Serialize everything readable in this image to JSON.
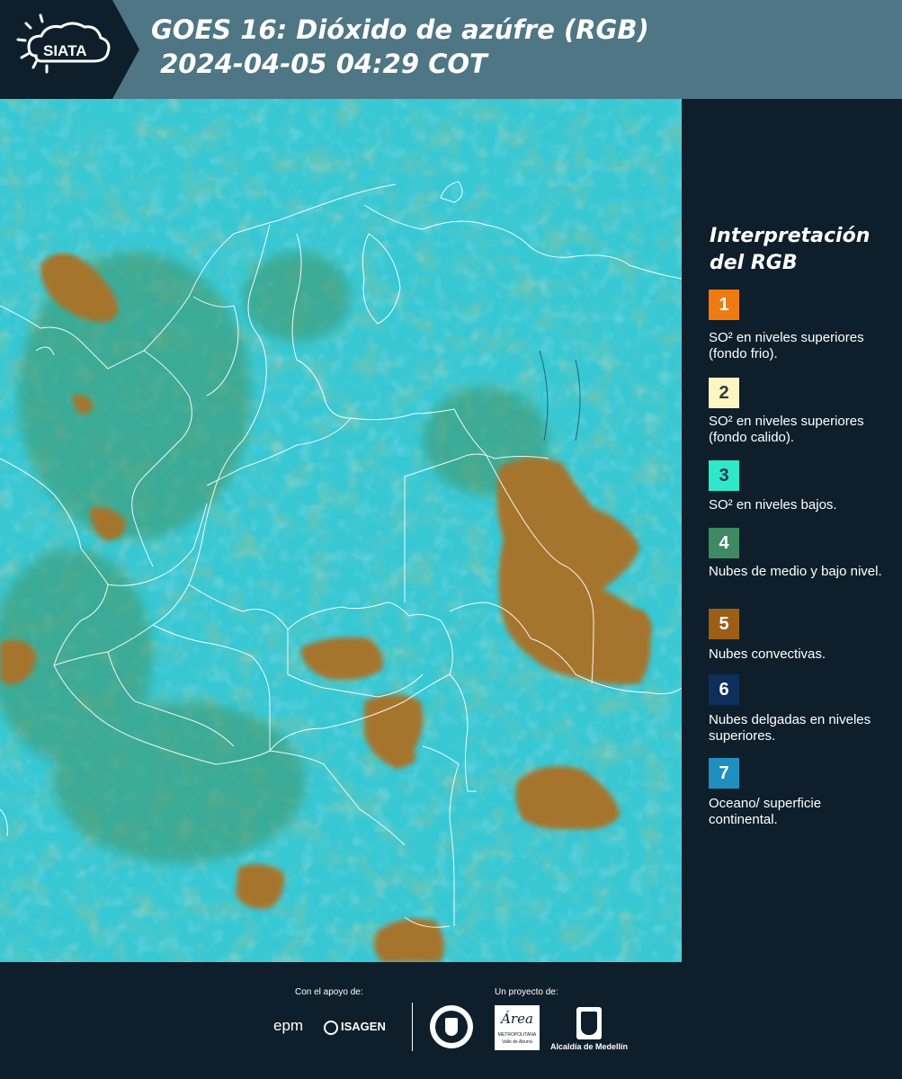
{
  "header": {
    "logo_text": "SIATA",
    "title_line1": "GOES 16: Dióxido de azúfre (RGB)",
    "title_line2": " 2024-04-05 04:29 COT"
  },
  "legend": {
    "title": "Interpretación del RGB",
    "items": [
      {
        "number": "1",
        "label": "SO² en niveles superiores (fondo frio).",
        "color": "#f07a12"
      },
      {
        "number": "2",
        "label": "SO² en niveles superiores (fondo calido).",
        "color": "#fdf5c2"
      },
      {
        "number": "3",
        "label": "SO² en niveles bajos.",
        "color": "#2fe8c9"
      },
      {
        "number": "4",
        "label": "Nubes de medio y bajo nivel.",
        "color": "#3e8a62"
      },
      {
        "number": "5",
        "label": "Nubes convectivas.",
        "color": "#9a5e17"
      },
      {
        "number": "6",
        "label": "Nubes delgadas en niveles superiores.",
        "color": "#0e2f5c"
      },
      {
        "number": "7",
        "label": "Oceano/ superficie continental.",
        "color": "#1e8fbf"
      }
    ]
  },
  "footer": {
    "support_label": "Con el apoyo de:",
    "project_label": "Un proyecto de:",
    "sponsor_epm": "epm",
    "sponsor_isagen": "ISAGEN",
    "sponsor_area": "Área",
    "sponsor_area_sub": "METROPOLITANA",
    "sponsor_area_sub2": "Valle de Aburrá",
    "sponsor_alcaldia": "Alcaldía de Medellín"
  },
  "colors": {
    "header_bg": "#4e7684",
    "panel_bg": "#0e1f2b",
    "map_base": "#37c9d3",
    "low_cloud": "#3f9a73",
    "convective": "#a5742f"
  }
}
